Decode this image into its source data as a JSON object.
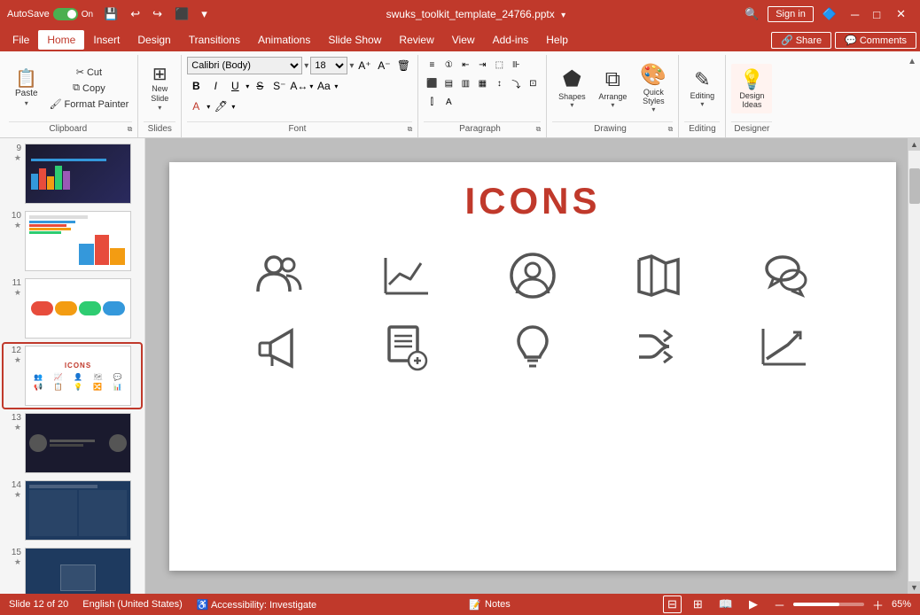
{
  "titleBar": {
    "autoSave": "AutoSave",
    "fileName": "swuks_toolkit_template_24766.pptx",
    "signIn": "Sign in",
    "undoTitle": "Undo",
    "redoTitle": "Redo",
    "minimize": "─",
    "maximize": "□",
    "close": "✕"
  },
  "menuBar": {
    "items": [
      "File",
      "Home",
      "Insert",
      "Design",
      "Transitions",
      "Animations",
      "Slide Show",
      "Review",
      "View",
      "Add-ins",
      "Help"
    ]
  },
  "ribbon": {
    "groups": {
      "clipboard": "Clipboard",
      "slides": "Slides",
      "font": "Font",
      "paragraph": "Paragraph",
      "drawing": "Drawing",
      "editing": "Editing",
      "designer": "Designer"
    },
    "buttons": {
      "paste": "Paste",
      "cut": "Cut",
      "copy": "Copy",
      "formatPainter": "Format Painter",
      "newSlide": "New Slide",
      "shapes": "Shapes",
      "arrange": "Arrange",
      "quickStyles": "Quick Styles",
      "editing": "Editing",
      "designIdeas": "Design Ideas",
      "share": "Share",
      "comments": "Comments"
    },
    "fontFamily": "Calibri (Body)",
    "fontSize": "18",
    "fontPlaceholder": "Calibri (Body)"
  },
  "slides": [
    {
      "num": "9",
      "star": "★"
    },
    {
      "num": "10",
      "star": "★"
    },
    {
      "num": "11",
      "star": "★"
    },
    {
      "num": "12",
      "star": "★",
      "active": true
    },
    {
      "num": "13",
      "star": "★"
    },
    {
      "num": "14",
      "star": "★"
    },
    {
      "num": "15",
      "star": "★"
    }
  ],
  "slideContent": {
    "title": "ICONS"
  },
  "statusBar": {
    "slideInfo": "Slide 12 of 20",
    "language": "English (United States)",
    "accessibility": "Accessibility: Investigate",
    "notes": "Notes",
    "zoomLevel": "65%"
  }
}
